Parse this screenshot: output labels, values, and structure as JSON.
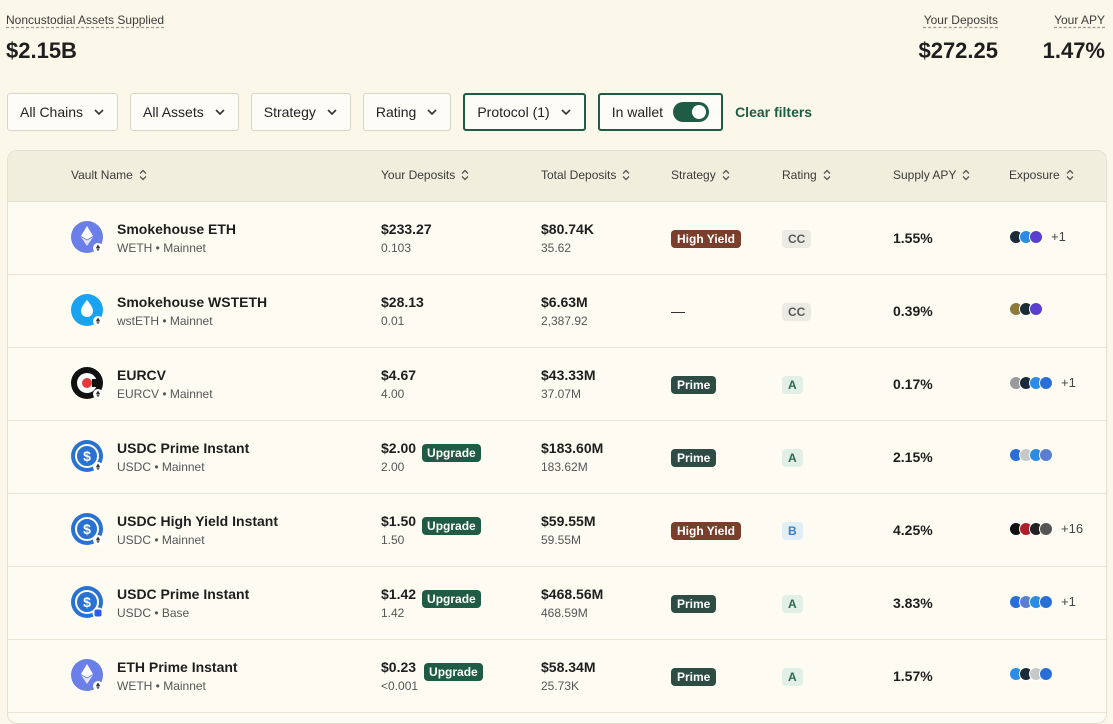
{
  "stats": {
    "supplied_label": "Noncustodial Assets Supplied",
    "supplied_value": "$2.15B",
    "deposits_label": "Your Deposits",
    "deposits_value": "$272.25",
    "apy_label": "Your APY",
    "apy_value": "1.47%"
  },
  "filters": {
    "chains": "All Chains",
    "assets": "All Assets",
    "strategy": "Strategy",
    "rating": "Rating",
    "protocol": "Protocol (1)",
    "wallet": "In wallet",
    "clear": "Clear filters"
  },
  "colors": {
    "accent": "#1f5b45",
    "high_yield": "#7a3e2c",
    "prime": "#2e4c43",
    "background": "#fbf8ea"
  },
  "table": {
    "headers": {
      "vault_name": "Vault Name",
      "your_deposits": "Your Deposits",
      "total_deposits": "Total Deposits",
      "strategy": "Strategy",
      "rating": "Rating",
      "supply_apy": "Supply APY",
      "exposure": "Exposure"
    },
    "rows": [
      {
        "name": "Smokehouse ETH",
        "sub": "WETH • Mainnet",
        "icon": "eth-icon",
        "dep": "$233.27",
        "dep_sub": "0.103",
        "upgrade": "",
        "total": "$80.74K",
        "total_sub": "35.62",
        "strategy": "High Yield",
        "rating": "CC",
        "apy": "1.55%",
        "exposure_colors": [
          "#1c2b3a",
          "#2b8be5",
          "#5a3fd1"
        ],
        "exposure_more": "+1"
      },
      {
        "name": "Smokehouse WSTETH",
        "sub": "wstETH • Mainnet",
        "icon": "wsteth-icon",
        "dep": "$28.13",
        "dep_sub": "0.01",
        "upgrade": "",
        "total": "$6.63M",
        "total_sub": "2,387.92",
        "strategy": "—",
        "rating": "CC",
        "apy": "0.39%",
        "exposure_colors": [
          "#8c7a3b",
          "#1c2b3a",
          "#5a3fd1"
        ],
        "exposure_more": ""
      },
      {
        "name": "EURCV",
        "sub": "EURCV • Mainnet",
        "icon": "eurcv-icon",
        "dep": "$4.67",
        "dep_sub": "4.00",
        "upgrade": "",
        "total": "$43.33M",
        "total_sub": "37.07M",
        "strategy": "Prime",
        "rating": "A",
        "apy": "0.17%",
        "exposure_colors": [
          "#9a9a9a",
          "#1c2b3a",
          "#2b8be5",
          "#2b6fd6"
        ],
        "exposure_more": "+1"
      },
      {
        "name": "USDC Prime Instant",
        "sub": "USDC • Mainnet",
        "icon": "usdc-icon",
        "dep": "$2.00",
        "dep_sub": "2.00",
        "upgrade": "Upgrade",
        "total": "$183.60M",
        "total_sub": "183.62M",
        "strategy": "Prime",
        "rating": "A",
        "apy": "2.15%",
        "exposure_colors": [
          "#2b6fd6",
          "#c8c8c8",
          "#2b8be5",
          "#5a7fd1"
        ],
        "exposure_more": ""
      },
      {
        "name": "USDC High Yield Instant",
        "sub": "USDC • Mainnet",
        "icon": "usdc-icon",
        "dep": "$1.50",
        "dep_sub": "1.50",
        "upgrade": "Upgrade",
        "total": "$59.55M",
        "total_sub": "59.55M",
        "strategy": "High Yield",
        "rating": "B",
        "apy": "4.25%",
        "exposure_colors": [
          "#111111",
          "#b01e2b",
          "#222222",
          "#555555"
        ],
        "exposure_more": "+16"
      },
      {
        "name": "USDC Prime Instant",
        "sub": "USDC • Base",
        "icon": "usdc-icon",
        "dep": "$1.42",
        "dep_sub": "1.42",
        "upgrade": "Upgrade",
        "total": "$468.56M",
        "total_sub": "468.59M",
        "strategy": "Prime",
        "rating": "A",
        "apy": "3.83%",
        "exposure_colors": [
          "#2b6fd6",
          "#5a7fd1",
          "#2b8be5",
          "#2b6fd6"
        ],
        "exposure_more": "+1"
      },
      {
        "name": "ETH Prime Instant",
        "sub": "WETH • Mainnet",
        "icon": "eth-icon",
        "dep": "$0.23",
        "dep_sub": "<0.001",
        "upgrade": "Upgrade",
        "total": "$58.34M",
        "total_sub": "25.73K",
        "strategy": "Prime",
        "rating": "A",
        "apy": "1.57%",
        "exposure_colors": [
          "#2b8be5",
          "#1c2b3a",
          "#c8c8c8",
          "#2b6fd6"
        ],
        "exposure_more": ""
      }
    ]
  }
}
